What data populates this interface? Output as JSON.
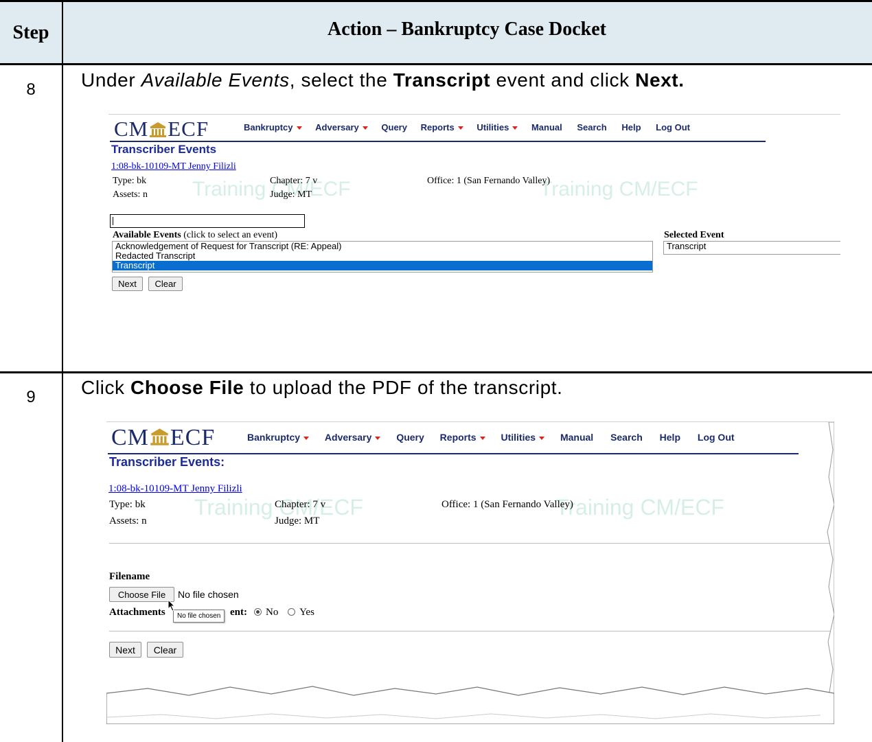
{
  "header": {
    "step": "Step",
    "action": "Action – Bankruptcy Case Docket"
  },
  "steps": [
    {
      "number": "8",
      "instruction": {
        "pre": "Under ",
        "em": "Available Events",
        "mid": ", select the ",
        "b1": "Transcript",
        "mid2": " event and click ",
        "b2": "Next."
      },
      "screen": {
        "logo_left": "CM",
        "logo_right": "ECF",
        "menu": [
          "Bankruptcy",
          "Adversary",
          "Query",
          "Reports",
          "Utilities",
          "Manual",
          "Search",
          "Help",
          "Log Out"
        ],
        "page_title": "Transcriber Events",
        "case_link": "1:08-bk-10109-MT Jenny Filizli",
        "type": "Type: bk",
        "chapter": "Chapter: 7 v",
        "office": "Office: 1 (San Fernando Valley)",
        "assets": "Assets: n",
        "judge": "Judge: MT",
        "watermark": "Training CM/ECF",
        "available_label_bold": "Available Events",
        "available_label_rest": " (click to select an event)",
        "events": [
          "Acknowledgement of Request for Transcript (RE: Appeal)",
          "Redacted Transcript",
          "Transcript"
        ],
        "selected_index": 2,
        "selected_label": "Selected Event",
        "selected_value": "Transcript",
        "next": "Next",
        "clear": "Clear"
      }
    },
    {
      "number": "9",
      "instruction": {
        "pre": "Click ",
        "b1": "Choose File",
        "post": " to upload the PDF of the transcript."
      },
      "screen": {
        "logo_left": "CM",
        "logo_right": "ECF",
        "menu": [
          "Bankruptcy",
          "Adversary",
          "Query",
          "Reports",
          "Utilities",
          "Manual",
          "Search",
          "Help",
          "Log Out"
        ],
        "page_title": "Transcriber Events:",
        "case_link": "1:08-bk-10109-MT Jenny Filizli",
        "type": "Type: bk",
        "chapter": "Chapter: 7 v",
        "office": "Office: 1 (San Fernando Valley)",
        "assets": "Assets: n",
        "judge": "Judge: MT",
        "watermark": "Training CM/ECF",
        "filename_label": "Filename",
        "choose_file": "Choose File",
        "no_file": "No file chosen",
        "attachments_pre": "Attachments",
        "attachments_post": "ent:",
        "radio_no": "No",
        "radio_yes": "Yes",
        "tooltip": "No file chosen",
        "next": "Next",
        "clear": "Clear"
      }
    }
  ],
  "colors": {
    "header_bg": "#dfeaf1",
    "brand_navy": "#1b2a6b",
    "selection_blue": "#0a6ed1",
    "watermark": "#d6efe6"
  }
}
